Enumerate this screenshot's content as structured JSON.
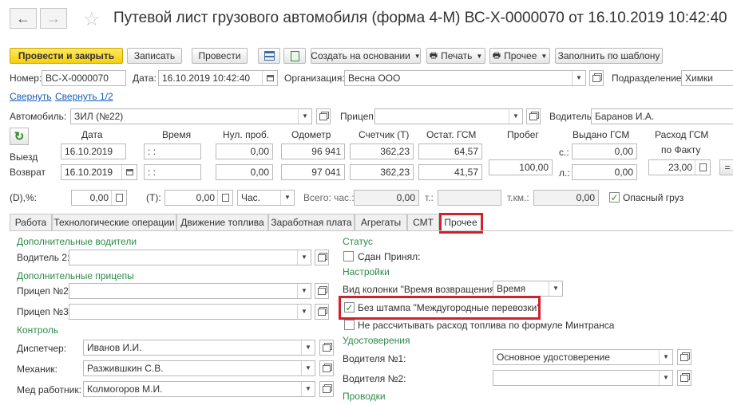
{
  "header": {
    "title": "Путевой лист грузового автомобиля (форма 4-М) ВС-Х-0000070 от 16.10.2019 10:42:40",
    "back_icon": "←",
    "forward_icon": "→",
    "star_icon": "☆"
  },
  "toolbar": {
    "post_close": "Провести и закрыть",
    "save": "Записать",
    "post": "Провести",
    "create_based": "Создать на основании",
    "print": "Печать",
    "other": "Прочее",
    "fill_template": "Заполнить по шаблону"
  },
  "doc": {
    "number_label": "Номер:",
    "number": "ВС-Х-0000070",
    "date_label": "Дата:",
    "date": "16.10.2019 10:42:40",
    "org_label": "Организация:",
    "org": "Весна ООО",
    "dept_label": "Подразделение:",
    "dept": "Химки"
  },
  "links": {
    "collapse": "Свернуть",
    "collapse_half": "Свернуть 1/2"
  },
  "vehicle": {
    "auto_label": "Автомобиль:",
    "auto": "ЗИЛ (№22)",
    "trailer_label": "Прицеп:",
    "trailer": "",
    "driver_label": "Водитель:",
    "driver": "Баранов И.А."
  },
  "grid": {
    "headers": {
      "date": "Дата",
      "time": "Время",
      "zero_run": "Нул. проб.",
      "odometer": "Одометр",
      "counter": "Счетчик (Т)",
      "fuel_rest": "Остат. ГСМ",
      "mileage": "Пробег",
      "fuel_issued": "Выдано ГСМ",
      "fuel_consumption": "Расход ГСМ",
      "by_fact": "по Факту"
    },
    "departure_label": "Выезд",
    "return_label": "Возврат",
    "departure": {
      "date": "16.10.2019",
      "time": " :  :",
      "zero": "0,00",
      "odometer": "96 941",
      "counter": "362,23",
      "fuel": "64,57"
    },
    "return": {
      "date": "16.10.2019",
      "time": " :  :",
      "zero": "0,00",
      "odometer": "97 041",
      "counter": "362,23",
      "fuel": "41,57"
    },
    "mileage": "100,00",
    "issued_s_label": "с.:",
    "issued_s": "0,00",
    "issued_l_label": "л.:",
    "issued_l": "0,00",
    "fact": "23,00",
    "eq": "="
  },
  "extra": {
    "d_label": "(D),%:",
    "d_value": "0,00",
    "t_label": "(T):",
    "t_value": "0,00",
    "unit": "Час.",
    "total_h_label": "Всего: час.:",
    "total_h": "0,00",
    "t2_label": "т.:",
    "t2": "",
    "tkm_label": "т.км.:",
    "tkm": "0,00",
    "hazard_label": "Опасный груз"
  },
  "tabs": [
    "Работа",
    "Технологические операции",
    "Движение топлива",
    "Заработная плата",
    "Агрегаты",
    "СМТ",
    "Прочее"
  ],
  "left": {
    "add_drivers": "Дополнительные водители",
    "driver2_label": "Водитель 2:",
    "driver2": "",
    "add_trailers": "Дополнительные прицепы",
    "trailer2_label": "Прицеп №2:",
    "trailer3_label": "Прицеп №3:",
    "control": "Контроль",
    "dispatcher_label": "Диспетчер:",
    "dispatcher": "Иванов И.И.",
    "mechanic_label": "Механик:",
    "mechanic": "Разжившкин С.В.",
    "medic_label": "Мед работник:",
    "medic": "Колмогоров М.И."
  },
  "right": {
    "status": "Статус",
    "handed_label": "Сдан",
    "accepted_label": "Принял:",
    "settings": "Настройки",
    "view_col_label": "Вид колонки \"Время возвращения\":",
    "view_col": "Время",
    "no_stamp_label": "Без штампа \"Междугородные перевозки\"",
    "no_calc_label": "Не рассчитывать расход топлива по формуле Минтранса",
    "license": "Удостоверения",
    "driver1_label": "Водителя №1:",
    "driver1": "Основное удостоверение",
    "driver2_label": "Водителя №2:",
    "driver2": "",
    "postings": "Проводки"
  },
  "colors": {
    "accent": "#f5cf0c",
    "section": "#2d8a4a",
    "link": "#1a5fb4",
    "highlight": "#d4202a"
  }
}
